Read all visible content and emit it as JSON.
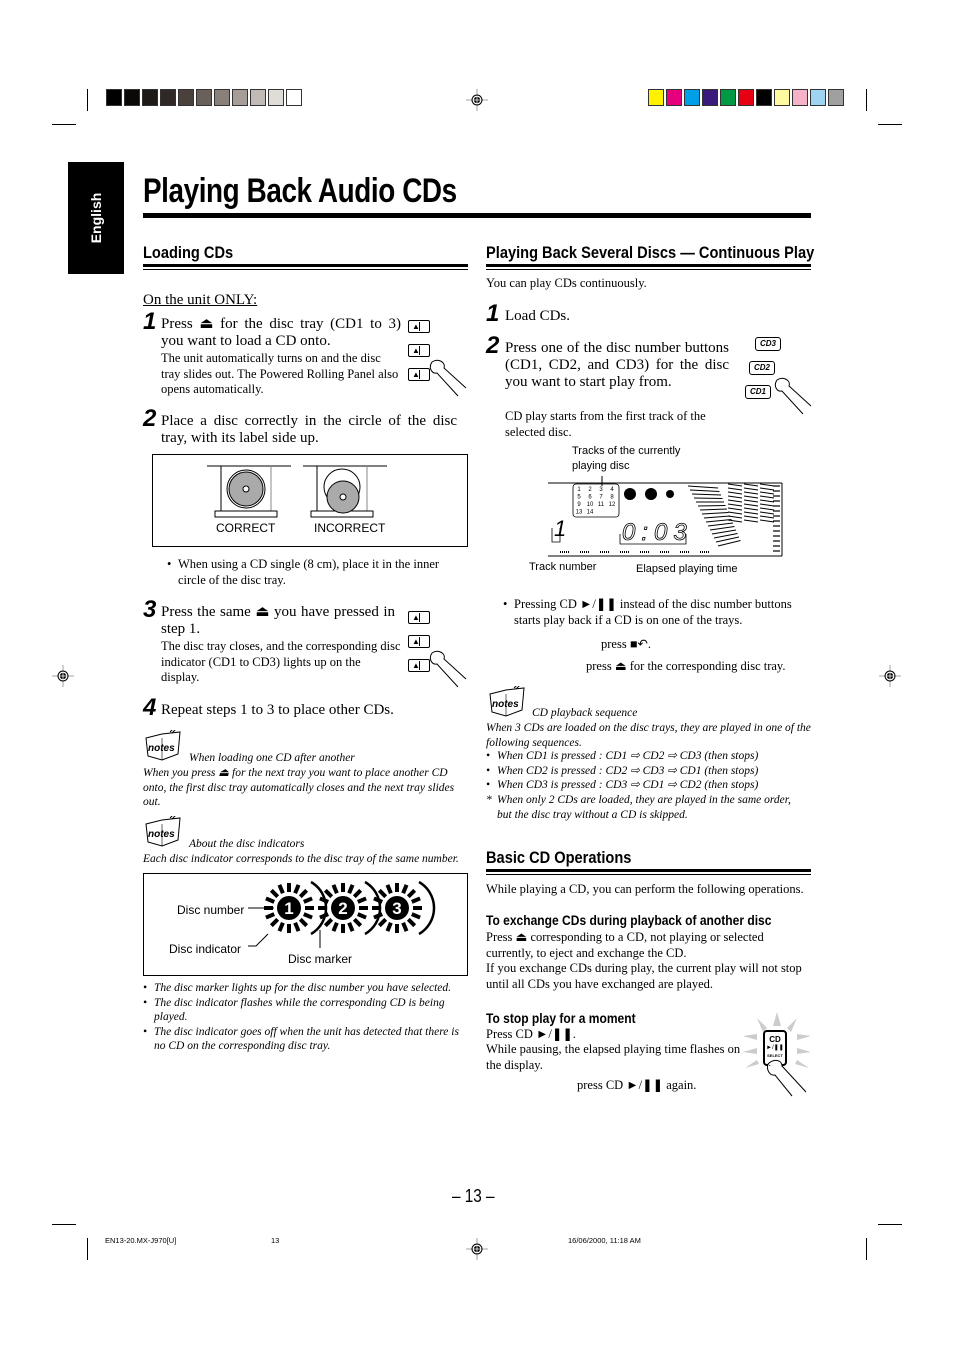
{
  "page": {
    "title": "Playing Back Audio CDs",
    "language_tab": "English",
    "page_number": "– 13 –",
    "footer": {
      "file": "EN13-20.MX-J970[U]",
      "sheet": "13",
      "timestamp": "16/06/2000, 11:18 AM"
    },
    "color_bar_gray": [
      "#000000",
      "#0a0908",
      "#1e1a18",
      "#302826",
      "#4a403c",
      "#6a605a",
      "#8a807a",
      "#a69c98",
      "#c2bab6",
      "#e0dcd8",
      "#ffffff"
    ],
    "color_bar_color": [
      "#fff200",
      "#e6007e",
      "#00a0e9",
      "#3a1a7a",
      "#009944",
      "#e60012",
      "#000000",
      "#fffaa0",
      "#f6b2c8",
      "#9ed4f2",
      "#a0a0a0"
    ]
  },
  "loading": {
    "heading": "Loading CDs",
    "intro": "On the unit ONLY:",
    "steps": [
      {
        "num": "1",
        "main": "Press ⏏ for the disc tray (CD1 to 3) you want to load a CD onto.",
        "detail": "The unit automatically turns on and the disc tray slides out. The Powered Rolling Panel also opens automatically."
      },
      {
        "num": "2",
        "main": "Place a disc correctly in the circle of the disc tray, with its label side up.",
        "detail": ""
      },
      {
        "num": "3",
        "main": "Press the same ⏏ you have pressed in step 1.",
        "detail": "The disc tray closes, and the corresponding disc indicator (CD1 to CD3) lights up on the display."
      },
      {
        "num": "4",
        "main": "Repeat steps 1 to 3 to place other CDs.",
        "detail": ""
      }
    ],
    "figure_labels": {
      "correct": "CORRECT",
      "incorrect": "INCORRECT"
    },
    "bullet": "When using a CD single (8 cm), place it in the inner circle of the disc tray.",
    "eject_glyph": "▲",
    "notes": [
      {
        "title": "When loading one CD after another",
        "body": "When you press ⏏ for the next tray you want to place another CD onto, the first disc tray automatically closes and the next tray slides out."
      },
      {
        "title": "About the disc indicators",
        "body": "Each disc indicator corresponds to the disc tray of the same number."
      }
    ],
    "notes_label": "notes",
    "indicator_fig": {
      "disc_number": "Disc number",
      "disc_indicator": "Disc indicator",
      "disc_marker": "Disc marker",
      "numbers": [
        "1",
        "2",
        "3"
      ]
    },
    "indicator_bullets": [
      "The disc marker lights up for the disc number you have selected.",
      "The disc indicator flashes while the corresponding CD is being played.",
      "The disc indicator goes off when the unit has detected that there is no CD on the corresponding disc tray."
    ]
  },
  "continuous": {
    "heading": "Playing Back Several Discs — Continuous Play",
    "intro": "You can play CDs continuously.",
    "steps": [
      {
        "num": "1",
        "main": "Load CDs.",
        "detail": ""
      },
      {
        "num": "2",
        "main": "Press one of the disc number buttons (CD1, CD2, and CD3) for the disc you want to start play from.",
        "detail": "CD play starts from the first track of the selected disc."
      }
    ],
    "cd_buttons": [
      "CD3",
      "CD2",
      "CD1"
    ],
    "display_fig": {
      "tracks_label": "Tracks of the currently playing disc",
      "track_number_label": "Track number",
      "elapsed_label": "Elapsed playing time",
      "track_numbers": [
        "1",
        "2",
        "3",
        "4",
        "5",
        "6",
        "7",
        "8",
        "9",
        "10",
        "11",
        "12",
        "13",
        "14"
      ],
      "track_digit": "1",
      "elapsed": "0:03"
    },
    "bullet": "Pressing CD ►/❚❚ instead of the disc number buttons starts play back if a CD is on one of the trays.",
    "stop_line": "press ■↶.",
    "eject_line": "press ⏏ for the corresponding disc tray.",
    "note": {
      "title": "CD playback sequence",
      "body": "When 3 CDs are loaded on the disc trays, they are played in one of the following sequences.",
      "items": [
        "When CD1 is pressed : CD1 ⇨ CD2 ⇨ CD3 (then stops)",
        "When CD2 is pressed : CD2 ⇨ CD3 ⇨ CD1 (then stops)",
        "When CD3 is pressed : CD3 ⇨ CD1 ⇨ CD2 (then stops)"
      ],
      "asterisk": "When only 2 CDs are loaded, they are played in the same order, but the disc tray without a CD is skipped."
    }
  },
  "basic": {
    "heading": "Basic CD Operations",
    "intro": "While playing a CD, you can perform the following operations.",
    "exchange": {
      "title": "To exchange CDs during playback of another disc",
      "p1": "Press ⏏ corresponding to a CD, not playing or selected currently, to eject and exchange the CD.",
      "p2": "If you exchange CDs during play, the current play will not stop until all CDs you have exchanged are played."
    },
    "pause": {
      "title": "To stop play for a moment",
      "p1": "Press CD ►/❚❚.",
      "p2": "While pausing, the elapsed playing time flashes on the display.",
      "p3": "press CD ►/❚❚ again.",
      "button_top": "CD",
      "button_mid": "►/❚❚",
      "button_bottom": "SELECT"
    }
  }
}
